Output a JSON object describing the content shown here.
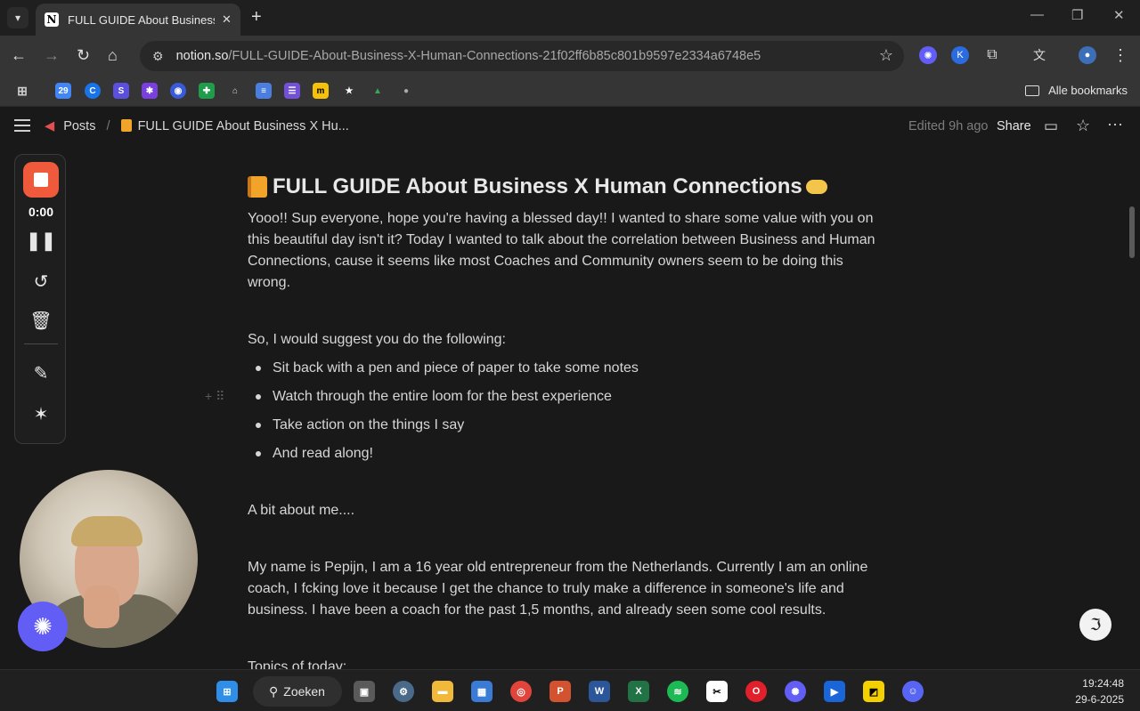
{
  "browser": {
    "tab_title": "FULL GUIDE About Business X Hu",
    "url_host": "notion.so",
    "url_path": "/FULL-GUIDE-About-Business-X-Human-Connections-21f02ff6b85c801b9597e2334a6748e5",
    "bookmarks_all_label": "Alle bookmarks"
  },
  "notion": {
    "breadcrumb_posts": "Posts",
    "breadcrumb_separator": "/",
    "breadcrumb_page": "FULL GUIDE About Business X Hu...",
    "edited": "Edited 9h ago",
    "share_label": "Share"
  },
  "recorder": {
    "time": "0:00"
  },
  "page": {
    "title": "FULL GUIDE About Business X Human Connections",
    "intro_lines": [
      "Yooo!! Sup everyone, hope you're having a blessed day!! I wanted to share some value with you on",
      "this beautiful day isn't it? Today I wanted to talk about the correlation between Business and Human",
      "Connections, cause it seems like most Coaches and Community owners seem to be doing this",
      "wrong."
    ],
    "suggest": "So, I would suggest you do the following:",
    "bullets": [
      "Sit back with a pen and piece of paper to take some notes",
      "Watch through the entire loom for the best experience",
      "Take action on the things I say",
      "And read along!"
    ],
    "about_heading": "A bit about me....",
    "about_lines": [
      "My name is Pepijn, I am a 16 year old entrepreneur from the Netherlands. Currently I am an online",
      "coach, I fcking love it because I get the chance to truly make a difference in someone's life and",
      "business. I have been a coach for the past 1,5 months, and already seen some cool results."
    ],
    "topics": "Topics of today:"
  },
  "taskbar": {
    "search_label": "Zoeken",
    "time": "19:24:48",
    "date": "29-6-2025"
  },
  "colors": {
    "accent_record": "#ef5a3c",
    "loom_purple": "#625df5",
    "notion_bg": "#191919"
  }
}
